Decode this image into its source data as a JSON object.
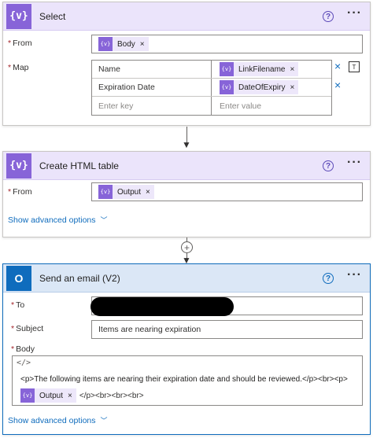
{
  "select_card": {
    "icon": "{v}",
    "title": "Select",
    "help": "?",
    "more": "···",
    "from_label": "From",
    "map_label": "Map",
    "from_token": "Body",
    "map_rows": [
      {
        "key": "Name",
        "value_token": "LinkFilename"
      },
      {
        "key": "Expiration Date",
        "value_token": "DateOfExpiry"
      }
    ],
    "key_placeholder": "Enter key",
    "value_placeholder": "Enter value"
  },
  "html_card": {
    "icon": "{v}",
    "title": "Create HTML table",
    "help": "?",
    "more": "···",
    "from_label": "From",
    "from_token": "Output",
    "advanced": "Show advanced options"
  },
  "email_card": {
    "icon": "O",
    "title": "Send an email (V2)",
    "help": "?",
    "more": "···",
    "to_label": "To",
    "subject_label": "Subject",
    "body_label": "Body",
    "subject_value": "Items are nearing expiration",
    "code_toggle": "</>",
    "body_line1": "<p>The following items are nearing their expiration date and should be reviewed.</p><br><p>",
    "body_token": "Output",
    "body_line2_tail": "</p><br><br><br>",
    "advanced": "Show advanced options"
  },
  "token_icon": "{v}",
  "close_glyph": "×",
  "required_mark": "*",
  "colors": {
    "control_header": "#ebe4fb",
    "control_icon": "#8764d8",
    "outlook_header": "#dbe7f6",
    "outlook_icon": "#0f6cbd",
    "link": "#0f6cbd"
  }
}
